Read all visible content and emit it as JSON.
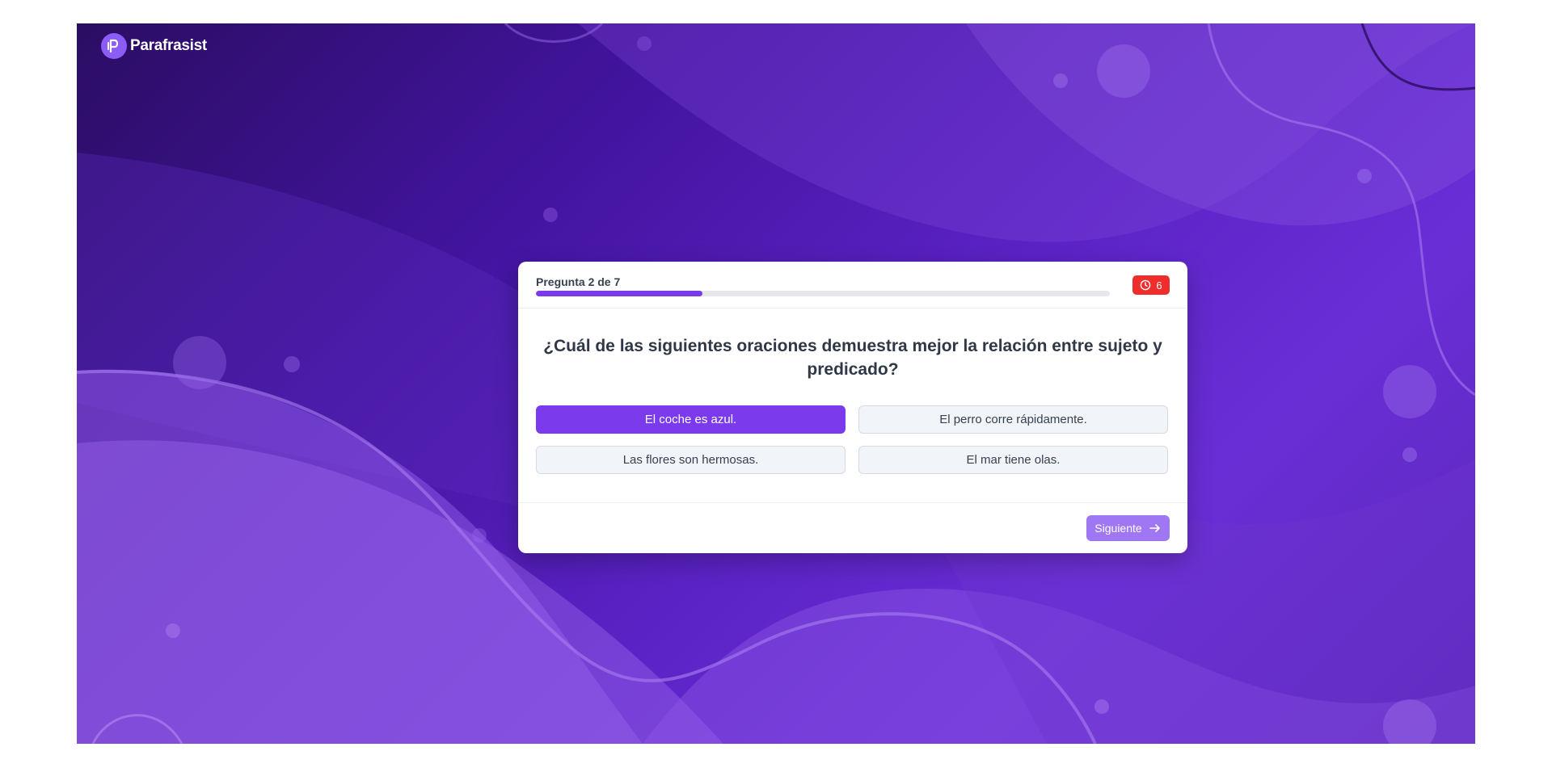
{
  "brand": {
    "name": "Parafrasist"
  },
  "quiz": {
    "progress_label": "Pregunta 2 de 7",
    "progress_fraction": 0.29,
    "timer_value": "6",
    "question": "¿Cuál de las siguientes oraciones demuestra mejor la relación entre sujeto y predicado?",
    "options": [
      {
        "label": "El coche es azul.",
        "selected": true
      },
      {
        "label": "El perro corre rápidamente.",
        "selected": false
      },
      {
        "label": "Las flores son hermosas.",
        "selected": false
      },
      {
        "label": "El mar tiene olas.",
        "selected": false
      }
    ],
    "next_label": "Siguiente"
  },
  "colors": {
    "accent": "#7c3aed",
    "timer_bg": "#ef2d2d",
    "next_button": "#a077f2"
  },
  "icons": {
    "logo": "parafrasist-logo-icon",
    "timer": "clock-icon",
    "next": "arrow-right-icon"
  }
}
